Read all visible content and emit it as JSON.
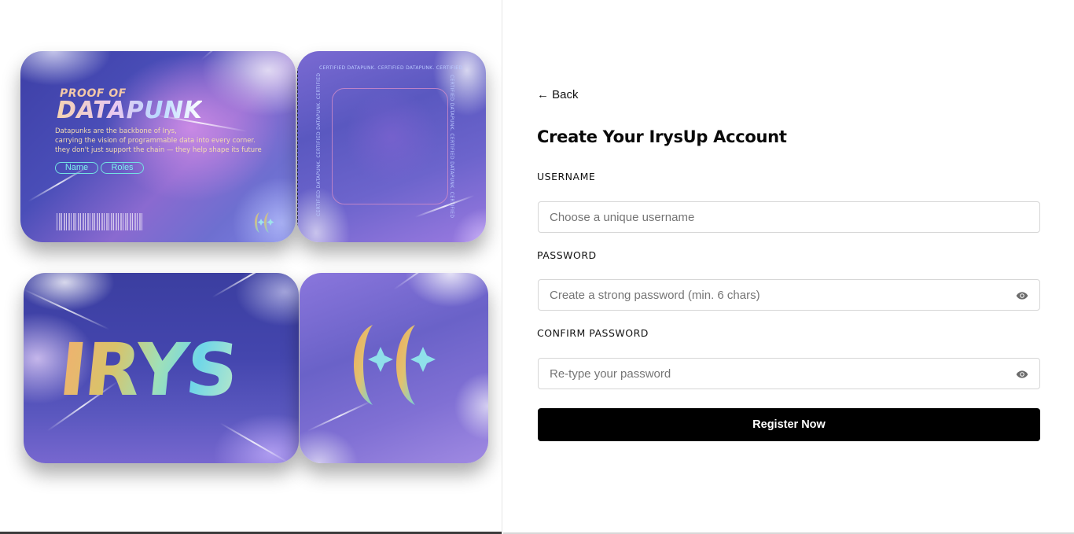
{
  "ticket_front": {
    "proof_of": "PROOF OF",
    "datapunk": "DATAPUNK",
    "description_lines": [
      "Datapunks are the backbone of Irys,",
      "carrying the vision of programmable data into every corner.",
      "they don't just support the chain — they help shape its future"
    ],
    "pill_name": "Name",
    "pill_roles": "Roles"
  },
  "ticket_stub": {
    "certified_text": "CERTIFIED DATAPUNK. CERTIFIED DATAPUNK. CERTIFIED",
    "certified_side": "CERTIFIED DATAPUNK. CERTIFIED DATAPUNK. CERTIFIED"
  },
  "ticket_back": {
    "word": "IRYS"
  },
  "form": {
    "back_label": "← Back",
    "title": "Create Your IrysUp Account",
    "username_label": "USERNAME",
    "username_placeholder": "Choose a unique username",
    "password_label": "PASSWORD",
    "password_placeholder": "Create a strong password (min. 6 chars)",
    "confirm_label": "CONFIRM PASSWORD",
    "confirm_placeholder": "Re-type your password",
    "submit_label": "Register Now",
    "password_toggle_icon": "eye-icon",
    "confirm_toggle_icon": "eye-icon"
  },
  "colors": {
    "button_bg": "#000000",
    "button_text": "#ffffff",
    "accent_cyan": "#74e3e3"
  }
}
